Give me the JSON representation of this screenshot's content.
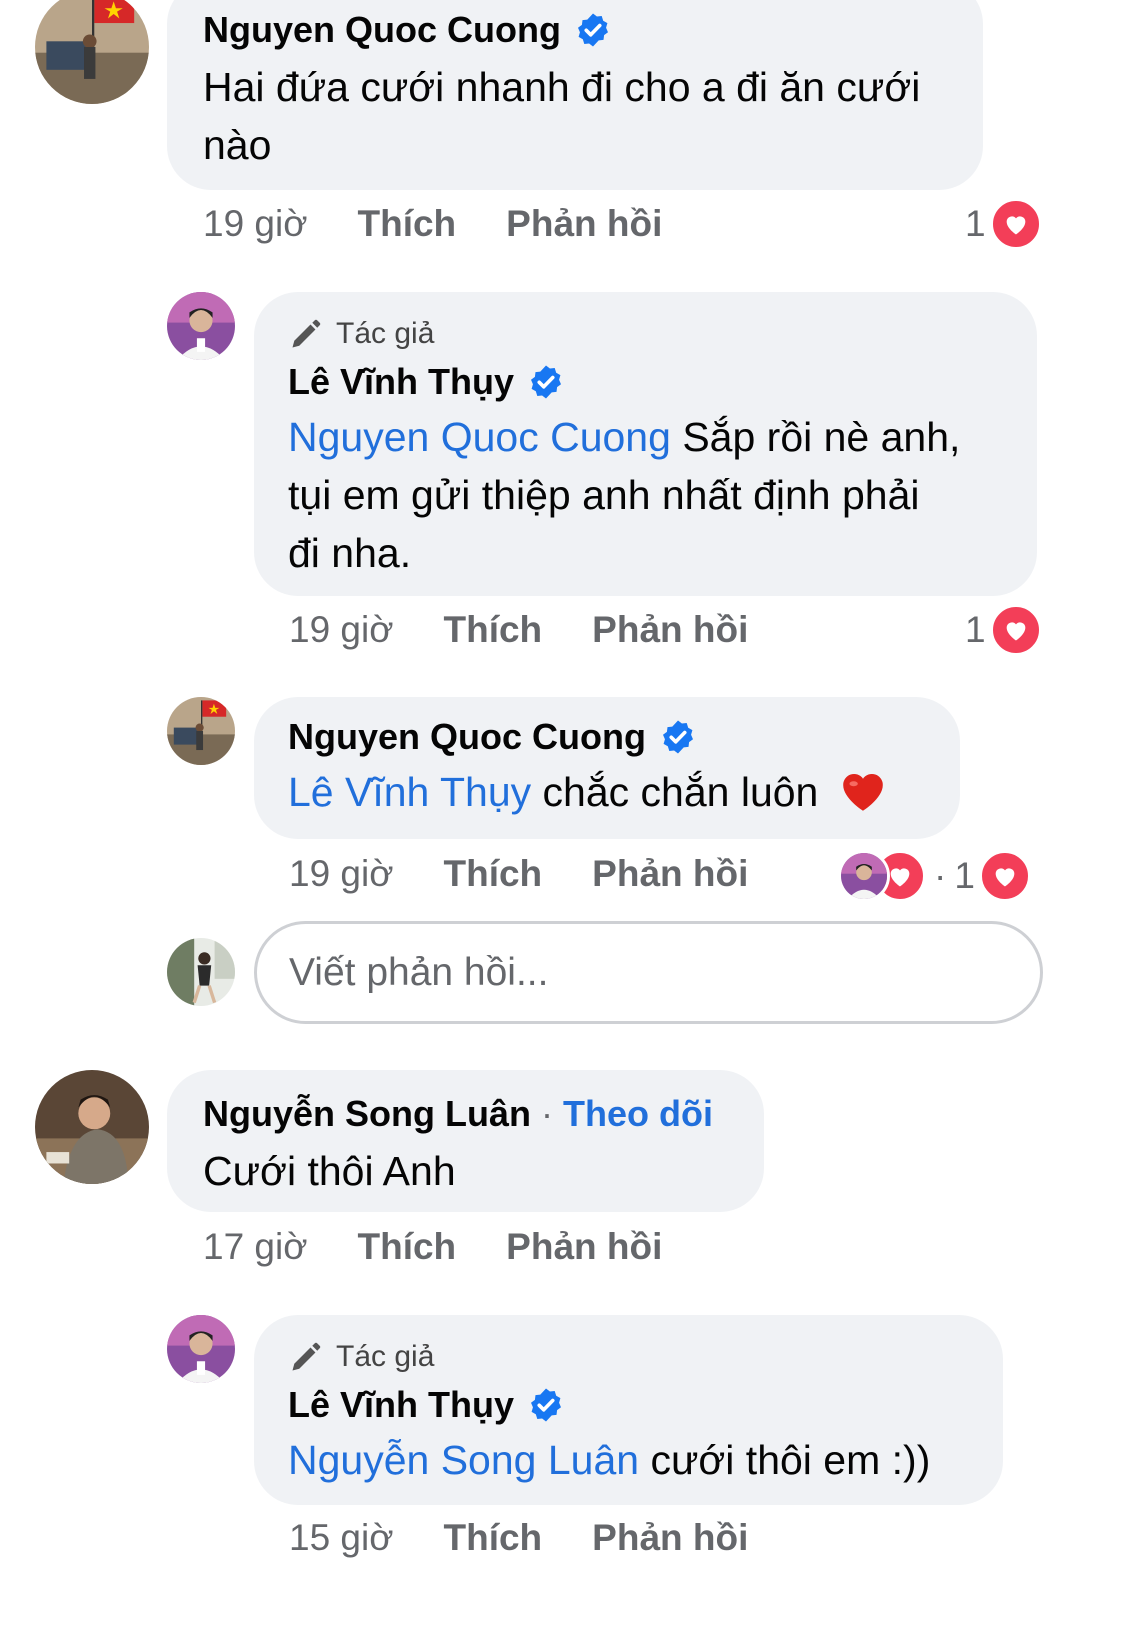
{
  "comments": [
    {
      "author": "Nguyen Quoc Cuong",
      "text": "Hai đứa cưới nhanh đi cho a đi ăn cưới nào",
      "time": "19 giờ",
      "like": "Thích",
      "reply": "Phản hồi",
      "reaction_count": "1"
    },
    {
      "author_tag": "Tác giả",
      "author": "Lê Vĩnh Thụy",
      "mention": "Nguyen Quoc Cuong",
      "text_line1": "Sắp rồi nè anh,",
      "text_line2": "tụi em gửi thiệp anh nhất định phải",
      "text_line3": "đi nha.",
      "time": "19 giờ",
      "like": "Thích",
      "reply": "Phản hồi",
      "reaction_count": "1"
    },
    {
      "author": "Nguyen Quoc Cuong",
      "mention": "Lê Vĩnh Thụy",
      "text": "chắc chắn luôn",
      "emoji": "❤️",
      "time": "19 giờ",
      "like": "Thích",
      "reply": "Phản hồi",
      "reaction_count": "1",
      "reaction_sep": "·"
    },
    {
      "author": "Nguyễn Song Luân",
      "follow": "Theo dõi",
      "follow_sep": "·",
      "text": "Cưới thôi Anh",
      "time": "17 giờ",
      "like": "Thích",
      "reply": "Phản hồi"
    },
    {
      "author_tag": "Tác giả",
      "author": "Lê Vĩnh Thụy",
      "mention": "Nguyễn Song Luân",
      "text": "cưới thôi em :))",
      "time": "15 giờ",
      "like": "Thích",
      "reply": "Phản hồi"
    }
  ],
  "reply_box": {
    "placeholder": "Viết phản hồi..."
  },
  "icons": {
    "verified": "verified-badge-icon",
    "author": "pen-icon",
    "reaction": "heart-icon"
  },
  "colors": {
    "mention": "#216fdb",
    "bubble": "#f0f2f5",
    "heart": "#f33e58",
    "verified": "#1877f2"
  }
}
